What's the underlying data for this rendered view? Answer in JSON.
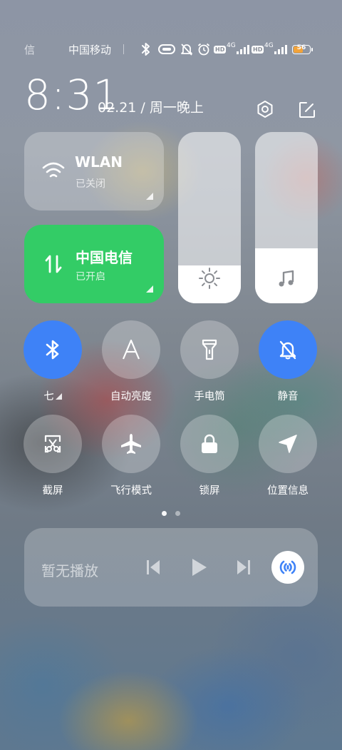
{
  "status_bar": {
    "left_partial": "信",
    "carrier": "中国移动",
    "network_1": "4G",
    "network_2": "4G",
    "hd_1": "HD",
    "hd_2": "HD",
    "battery": "56",
    "icons": [
      "bluetooth-icon",
      "vibrate-icon",
      "mute-bell-icon",
      "alarm-icon",
      "hd-icon",
      "signal-icon",
      "battery-icon"
    ]
  },
  "header": {
    "time": "8:31",
    "date": "02.21 / 周一晚上"
  },
  "tiles": {
    "wlan": {
      "title": "WLAN",
      "status": "已关闭",
      "active": false
    },
    "mobile": {
      "title": "中国电信",
      "status": "已开启",
      "active": true,
      "color": "#33cc66"
    }
  },
  "sliders": {
    "brightness": {
      "level": 0.22,
      "icon": "sun-icon"
    },
    "volume": {
      "level": 0.32,
      "icon": "music-note-icon"
    }
  },
  "toggles": [
    {
      "label": "七",
      "icon": "bluetooth-icon",
      "active": true
    },
    {
      "label": "自动亮度",
      "icon": "auto-brightness-icon",
      "active": false
    },
    {
      "label": "手电筒",
      "icon": "flashlight-icon",
      "active": false
    },
    {
      "label": "静音",
      "icon": "mute-bell-icon",
      "active": true
    },
    {
      "label": "截屏",
      "icon": "screenshot-icon",
      "active": false
    },
    {
      "label": "飞行模式",
      "icon": "airplane-icon",
      "active": false
    },
    {
      "label": "锁屏",
      "icon": "lock-icon",
      "active": false
    },
    {
      "label": "位置信息",
      "icon": "location-icon",
      "active": false
    }
  ],
  "page_indicator": {
    "current": 1,
    "total": 2
  },
  "media": {
    "status": "暂无播放",
    "controls": [
      "previous-icon",
      "play-icon",
      "next-icon",
      "cast-icon"
    ]
  },
  "colors": {
    "accent_blue": "#3e82f7",
    "accent_green": "#33cc66"
  }
}
